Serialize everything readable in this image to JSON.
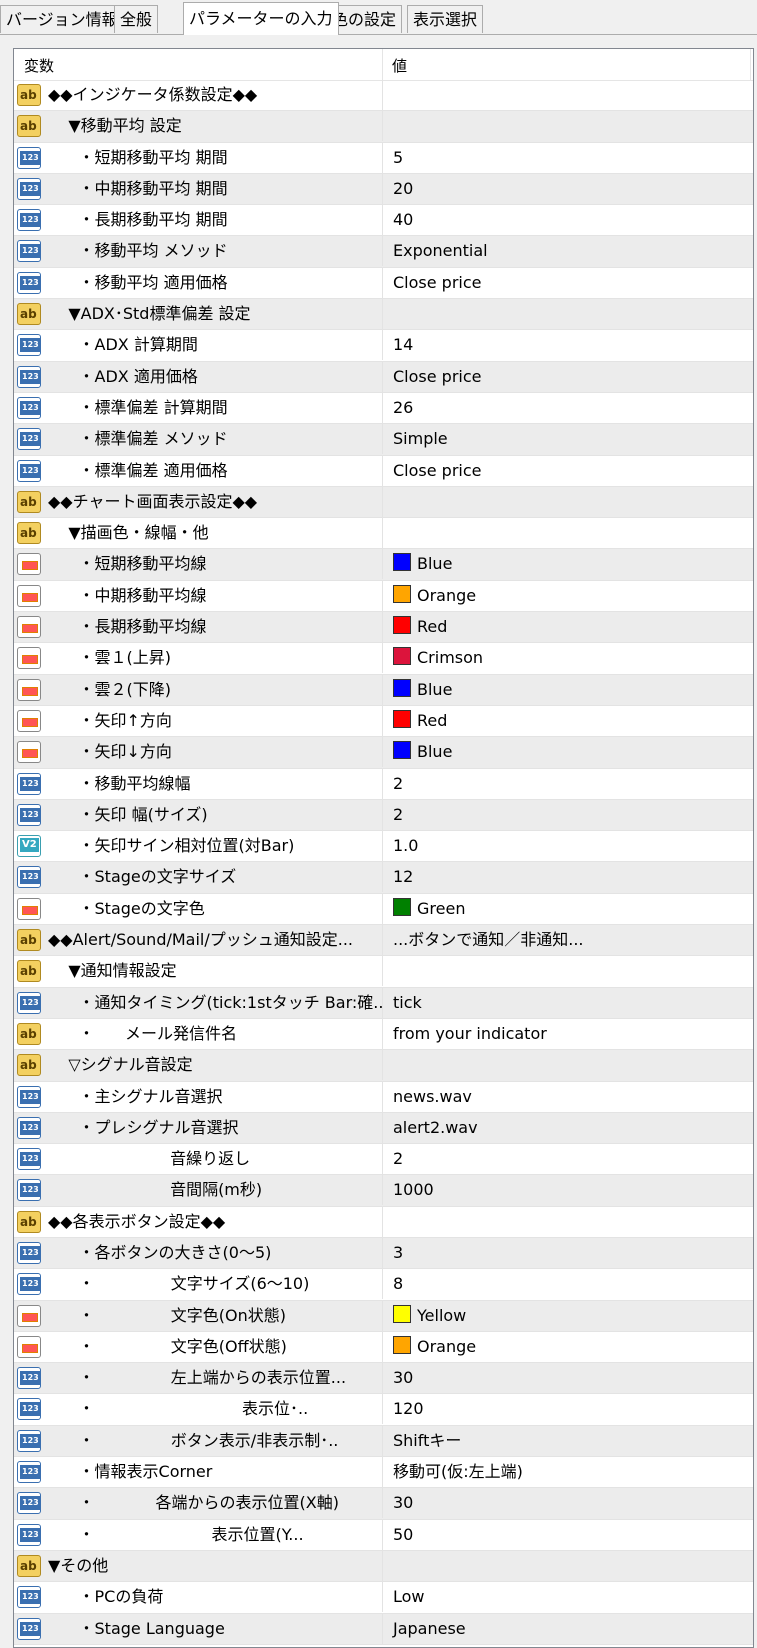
{
  "tabs": [
    "バージョン情報",
    "全般",
    "パラメーターの入力",
    "色の設定",
    "表示選択"
  ],
  "active_tab": 2,
  "header": {
    "name": "変数",
    "value": "値"
  },
  "rows": [
    {
      "icon": "ab",
      "name": "◆◆インジケータ係数設定◆◆",
      "value": ""
    },
    {
      "icon": "ab",
      "name": "    ▼移動平均 設定",
      "value": ""
    },
    {
      "icon": "123",
      "name": "      ・短期移動平均 期間",
      "value": "5"
    },
    {
      "icon": "123",
      "name": "      ・中期移動平均 期間",
      "value": "20"
    },
    {
      "icon": "123",
      "name": "      ・長期移動平均 期間",
      "value": "40"
    },
    {
      "icon": "123",
      "name": "      ・移動平均 メソッド",
      "value": "Exponential"
    },
    {
      "icon": "123",
      "name": "      ・移動平均 適用価格",
      "value": "Close price"
    },
    {
      "icon": "ab",
      "name": "    ▼ADX･Std標準偏差 設定",
      "value": ""
    },
    {
      "icon": "123",
      "name": "      ・ADX 計算期間",
      "value": "14"
    },
    {
      "icon": "123",
      "name": "      ・ADX 適用価格",
      "value": "Close price"
    },
    {
      "icon": "123",
      "name": "      ・標準偏差 計算期間",
      "value": "26"
    },
    {
      "icon": "123",
      "name": "      ・標準偏差 メソッド",
      "value": "Simple"
    },
    {
      "icon": "123",
      "name": "      ・標準偏差 適用価格",
      "value": "Close price"
    },
    {
      "icon": "ab",
      "name": "◆◆チャート画面表示設定◆◆",
      "value": ""
    },
    {
      "icon": "ab",
      "name": "    ▼描画色・線幅・他",
      "value": ""
    },
    {
      "icon": "color",
      "name": "      ・短期移動平均線",
      "value": "Blue",
      "swatch": "#0000ff"
    },
    {
      "icon": "color",
      "name": "      ・中期移動平均線",
      "value": "Orange",
      "swatch": "#ffa500"
    },
    {
      "icon": "color",
      "name": "      ・長期移動平均線",
      "value": "Red",
      "swatch": "#ff0000"
    },
    {
      "icon": "color",
      "name": "      ・雲１(上昇)",
      "value": "Crimson",
      "swatch": "#dc143c"
    },
    {
      "icon": "color",
      "name": "      ・雲２(下降)",
      "value": "Blue",
      "swatch": "#0000ff"
    },
    {
      "icon": "color",
      "name": "      ・矢印↑方向",
      "value": "Red",
      "swatch": "#ff0000"
    },
    {
      "icon": "color",
      "name": "      ・矢印↓方向",
      "value": "Blue",
      "swatch": "#0000ff"
    },
    {
      "icon": "123",
      "name": "      ・移動平均線幅",
      "value": "2"
    },
    {
      "icon": "123",
      "name": "      ・矢印 幅(サイズ)",
      "value": "2"
    },
    {
      "icon": "dbl",
      "name": "      ・矢印サイン相対位置(対Bar)",
      "value": "1.0"
    },
    {
      "icon": "123",
      "name": "      ・Stageの文字サイズ",
      "value": "12"
    },
    {
      "icon": "color",
      "name": "      ・Stageの文字色",
      "value": "Green",
      "swatch": "#008000"
    },
    {
      "icon": "ab",
      "name": "◆◆Alert/Sound/Mail/プッシュ通知設定...",
      "value": "...ボタンで通知／非通知..."
    },
    {
      "icon": "ab",
      "name": "    ▼通知情報設定",
      "value": ""
    },
    {
      "icon": "123",
      "name": "      ・通知タイミング(tick:1stタッチ Bar:確...",
      "value": "tick"
    },
    {
      "icon": "ab",
      "name": "      ・      メール発信件名",
      "value": "from your indicator"
    },
    {
      "icon": "ab",
      "name": "    ▽シグナル音設定",
      "value": ""
    },
    {
      "icon": "123",
      "name": "      ・主シグナル音選択",
      "value": "news.wav"
    },
    {
      "icon": "123",
      "name": "      ・プレシグナル音選択",
      "value": "alert2.wav"
    },
    {
      "icon": "123",
      "name": "                        音繰り返し",
      "value": "2"
    },
    {
      "icon": "123",
      "name": "                        音間隔(m秒)",
      "value": "1000"
    },
    {
      "icon": "ab",
      "name": "◆◆各表示ボタン設定◆◆",
      "value": ""
    },
    {
      "icon": "123",
      "name": "      ・各ボタンの大きさ(0～5)",
      "value": "3"
    },
    {
      "icon": "123",
      "name": "      ・               文字サイズ(6～10)",
      "value": "8"
    },
    {
      "icon": "color",
      "name": "      ・               文字色(On状態)",
      "value": "Yellow",
      "swatch": "#ffff00"
    },
    {
      "icon": "color",
      "name": "      ・               文字色(Off状態)",
      "value": "Orange",
      "swatch": "#ffa500"
    },
    {
      "icon": "123",
      "name": "      ・               左上端からの表示位置...",
      "value": "30"
    },
    {
      "icon": "123",
      "name": "      ・                             表示位･..",
      "value": "120"
    },
    {
      "icon": "123",
      "name": "      ・               ボタン表示/非表示制･..",
      "value": "Shiftキー"
    },
    {
      "icon": "123",
      "name": "      ・情報表示Corner",
      "value": "移動可(仮:左上端)"
    },
    {
      "icon": "123",
      "name": "      ・            各端からの表示位置(X軸)",
      "value": "30"
    },
    {
      "icon": "123",
      "name": "      ・                       表示位置(Y...",
      "value": "50"
    },
    {
      "icon": "ab",
      "name": "▼その他",
      "value": ""
    },
    {
      "icon": "123",
      "name": "      ・PCの負荷",
      "value": "Low"
    },
    {
      "icon": "123",
      "name": "      ・Stage Language",
      "value": "Japanese"
    }
  ],
  "icon_labels": {
    "ab": "ab",
    "123": "123",
    "dbl": "V2",
    "color": ""
  }
}
